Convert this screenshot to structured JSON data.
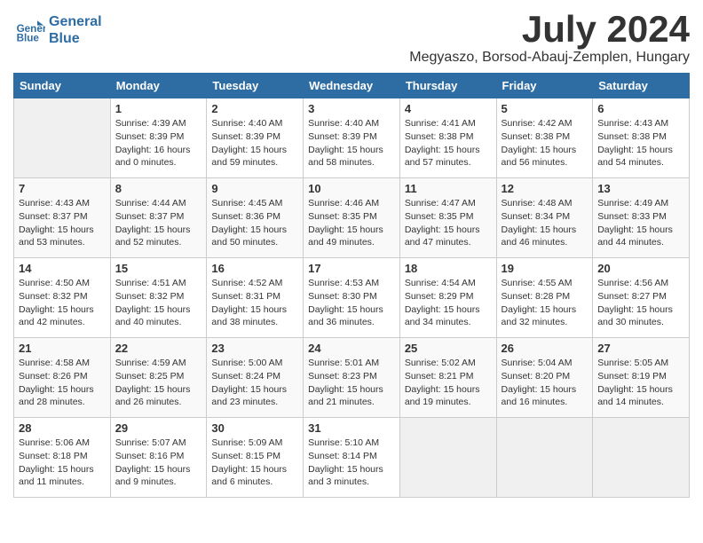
{
  "header": {
    "logo_line1": "General",
    "logo_line2": "Blue",
    "month_year": "July 2024",
    "location": "Megyaszo, Borsod-Abauj-Zemplen, Hungary"
  },
  "days_of_week": [
    "Sunday",
    "Monday",
    "Tuesday",
    "Wednesday",
    "Thursday",
    "Friday",
    "Saturday"
  ],
  "weeks": [
    [
      {
        "day": "",
        "sunrise": "",
        "sunset": "",
        "daylight": ""
      },
      {
        "day": "1",
        "sunrise": "Sunrise: 4:39 AM",
        "sunset": "Sunset: 8:39 PM",
        "daylight": "Daylight: 16 hours and 0 minutes."
      },
      {
        "day": "2",
        "sunrise": "Sunrise: 4:40 AM",
        "sunset": "Sunset: 8:39 PM",
        "daylight": "Daylight: 15 hours and 59 minutes."
      },
      {
        "day": "3",
        "sunrise": "Sunrise: 4:40 AM",
        "sunset": "Sunset: 8:39 PM",
        "daylight": "Daylight: 15 hours and 58 minutes."
      },
      {
        "day": "4",
        "sunrise": "Sunrise: 4:41 AM",
        "sunset": "Sunset: 8:38 PM",
        "daylight": "Daylight: 15 hours and 57 minutes."
      },
      {
        "day": "5",
        "sunrise": "Sunrise: 4:42 AM",
        "sunset": "Sunset: 8:38 PM",
        "daylight": "Daylight: 15 hours and 56 minutes."
      },
      {
        "day": "6",
        "sunrise": "Sunrise: 4:43 AM",
        "sunset": "Sunset: 8:38 PM",
        "daylight": "Daylight: 15 hours and 54 minutes."
      }
    ],
    [
      {
        "day": "7",
        "sunrise": "Sunrise: 4:43 AM",
        "sunset": "Sunset: 8:37 PM",
        "daylight": "Daylight: 15 hours and 53 minutes."
      },
      {
        "day": "8",
        "sunrise": "Sunrise: 4:44 AM",
        "sunset": "Sunset: 8:37 PM",
        "daylight": "Daylight: 15 hours and 52 minutes."
      },
      {
        "day": "9",
        "sunrise": "Sunrise: 4:45 AM",
        "sunset": "Sunset: 8:36 PM",
        "daylight": "Daylight: 15 hours and 50 minutes."
      },
      {
        "day": "10",
        "sunrise": "Sunrise: 4:46 AM",
        "sunset": "Sunset: 8:35 PM",
        "daylight": "Daylight: 15 hours and 49 minutes."
      },
      {
        "day": "11",
        "sunrise": "Sunrise: 4:47 AM",
        "sunset": "Sunset: 8:35 PM",
        "daylight": "Daylight: 15 hours and 47 minutes."
      },
      {
        "day": "12",
        "sunrise": "Sunrise: 4:48 AM",
        "sunset": "Sunset: 8:34 PM",
        "daylight": "Daylight: 15 hours and 46 minutes."
      },
      {
        "day": "13",
        "sunrise": "Sunrise: 4:49 AM",
        "sunset": "Sunset: 8:33 PM",
        "daylight": "Daylight: 15 hours and 44 minutes."
      }
    ],
    [
      {
        "day": "14",
        "sunrise": "Sunrise: 4:50 AM",
        "sunset": "Sunset: 8:32 PM",
        "daylight": "Daylight: 15 hours and 42 minutes."
      },
      {
        "day": "15",
        "sunrise": "Sunrise: 4:51 AM",
        "sunset": "Sunset: 8:32 PM",
        "daylight": "Daylight: 15 hours and 40 minutes."
      },
      {
        "day": "16",
        "sunrise": "Sunrise: 4:52 AM",
        "sunset": "Sunset: 8:31 PM",
        "daylight": "Daylight: 15 hours and 38 minutes."
      },
      {
        "day": "17",
        "sunrise": "Sunrise: 4:53 AM",
        "sunset": "Sunset: 8:30 PM",
        "daylight": "Daylight: 15 hours and 36 minutes."
      },
      {
        "day": "18",
        "sunrise": "Sunrise: 4:54 AM",
        "sunset": "Sunset: 8:29 PM",
        "daylight": "Daylight: 15 hours and 34 minutes."
      },
      {
        "day": "19",
        "sunrise": "Sunrise: 4:55 AM",
        "sunset": "Sunset: 8:28 PM",
        "daylight": "Daylight: 15 hours and 32 minutes."
      },
      {
        "day": "20",
        "sunrise": "Sunrise: 4:56 AM",
        "sunset": "Sunset: 8:27 PM",
        "daylight": "Daylight: 15 hours and 30 minutes."
      }
    ],
    [
      {
        "day": "21",
        "sunrise": "Sunrise: 4:58 AM",
        "sunset": "Sunset: 8:26 PM",
        "daylight": "Daylight: 15 hours and 28 minutes."
      },
      {
        "day": "22",
        "sunrise": "Sunrise: 4:59 AM",
        "sunset": "Sunset: 8:25 PM",
        "daylight": "Daylight: 15 hours and 26 minutes."
      },
      {
        "day": "23",
        "sunrise": "Sunrise: 5:00 AM",
        "sunset": "Sunset: 8:24 PM",
        "daylight": "Daylight: 15 hours and 23 minutes."
      },
      {
        "day": "24",
        "sunrise": "Sunrise: 5:01 AM",
        "sunset": "Sunset: 8:23 PM",
        "daylight": "Daylight: 15 hours and 21 minutes."
      },
      {
        "day": "25",
        "sunrise": "Sunrise: 5:02 AM",
        "sunset": "Sunset: 8:21 PM",
        "daylight": "Daylight: 15 hours and 19 minutes."
      },
      {
        "day": "26",
        "sunrise": "Sunrise: 5:04 AM",
        "sunset": "Sunset: 8:20 PM",
        "daylight": "Daylight: 15 hours and 16 minutes."
      },
      {
        "day": "27",
        "sunrise": "Sunrise: 5:05 AM",
        "sunset": "Sunset: 8:19 PM",
        "daylight": "Daylight: 15 hours and 14 minutes."
      }
    ],
    [
      {
        "day": "28",
        "sunrise": "Sunrise: 5:06 AM",
        "sunset": "Sunset: 8:18 PM",
        "daylight": "Daylight: 15 hours and 11 minutes."
      },
      {
        "day": "29",
        "sunrise": "Sunrise: 5:07 AM",
        "sunset": "Sunset: 8:16 PM",
        "daylight": "Daylight: 15 hours and 9 minutes."
      },
      {
        "day": "30",
        "sunrise": "Sunrise: 5:09 AM",
        "sunset": "Sunset: 8:15 PM",
        "daylight": "Daylight: 15 hours and 6 minutes."
      },
      {
        "day": "31",
        "sunrise": "Sunrise: 5:10 AM",
        "sunset": "Sunset: 8:14 PM",
        "daylight": "Daylight: 15 hours and 3 minutes."
      },
      {
        "day": "",
        "sunrise": "",
        "sunset": "",
        "daylight": ""
      },
      {
        "day": "",
        "sunrise": "",
        "sunset": "",
        "daylight": ""
      },
      {
        "day": "",
        "sunrise": "",
        "sunset": "",
        "daylight": ""
      }
    ]
  ]
}
